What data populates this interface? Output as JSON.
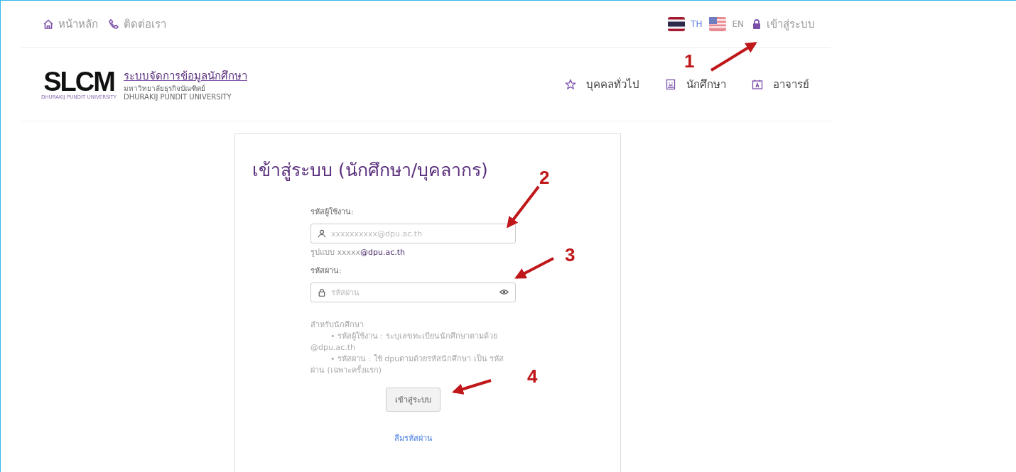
{
  "top_links": [
    {
      "kind": "home",
      "label": "หน้าหลัก"
    },
    {
      "kind": "phone",
      "label": "ติดต่อเรา"
    }
  ],
  "languages": [
    {
      "kind": "th",
      "code": "TH",
      "selected": true
    },
    {
      "kind": "us",
      "code": "EN",
      "selected": false
    }
  ],
  "login_link": "เข้าสู่ระบบ",
  "logo": {
    "mark": "SLCM",
    "tagline": "DHURAKIJ PUNDIT UNIVERSITY"
  },
  "site": {
    "title": "ระบบจัดการข้อมูลนักศึกษา",
    "subtitle": "มหาวิทยาลัยธุรกิจบัณฑิตย์",
    "subtitle_en": "DHURAKIJ PUNDIT UNIVERSITY"
  },
  "nav": [
    {
      "kind": "star",
      "label": "บุคคลทั่วไป"
    },
    {
      "kind": "student",
      "label": "นักศึกษา"
    },
    {
      "kind": "teacher",
      "label": "อาจารย์"
    }
  ],
  "login": {
    "title": "เข้าสู่ระบบ (นักศึกษา/บุคลากร)",
    "username": {
      "label": "รหัสผู้ใช้งาน:",
      "placeholder": "xxxxxxxxxx@dpu.ac.th",
      "hint": "รูปแบบ xxxxx**@dpu.ac.th**"
    },
    "password": {
      "label": "รหัสผ่าน:",
      "placeholder": "รหัสผ่าน"
    },
    "help_title": "สำหรับนักศึกษา",
    "help_items": [
      "• รหัสผู้ใช้งาน : ระบุเลขทะเบียนนักศึกษาตามด้วย @dpu.ac.th",
      "• รหัสผ่าน : ใช้ dpuตามด้วยรหัสนักศึกษา เป็น รหัสผ่าน (เฉพาะครั้งแรก)"
    ],
    "submit": "เข้าสู่ระบบ",
    "forgot": "ลืมรหัสผ่าน"
  },
  "annotations": [
    {
      "label": "1"
    },
    {
      "label": "2"
    },
    {
      "label": "3"
    },
    {
      "label": "4"
    }
  ]
}
